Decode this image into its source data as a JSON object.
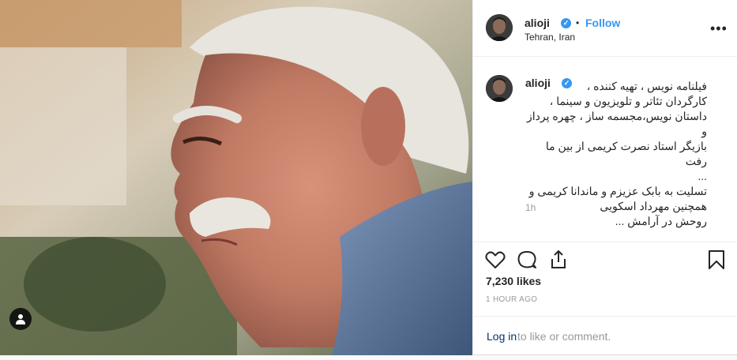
{
  "post": {
    "username": "alioji",
    "verified_mark": "✓",
    "separator": "•",
    "follow_label": "Follow",
    "location": "Tehran, Iran",
    "more_label": "•••",
    "caption_lines": [
      "فیلنامه نویس ، تهیه کننده ،",
      "کارگردان تئاتر و تلویزیون و سینما ،",
      "داستان نویس،مجسمه ساز ، چهره پرداز و",
      "بازیگر استاد نصرت کریمی از بین ما رفت",
      "...",
      "تسلیت به بابک عزیزم و ماندانا کریمی و",
      "همچنین مهرداد اسکویی",
      "روحش در آرامش ..."
    ],
    "caption_time": "1h",
    "likes": "7,230 likes",
    "posted_ago": "1 HOUR AGO",
    "login_link": "Log in",
    "login_rest": "to like or comment."
  },
  "icons": {
    "like": "heart-icon",
    "comment": "comment-icon",
    "share": "share-icon",
    "save": "bookmark-icon",
    "tag": "user-tag-icon",
    "more": "more-options-icon"
  },
  "colors": {
    "accent": "#3897f0",
    "link": "#003569",
    "muted": "#999999",
    "text": "#262626",
    "border": "#efefef"
  }
}
